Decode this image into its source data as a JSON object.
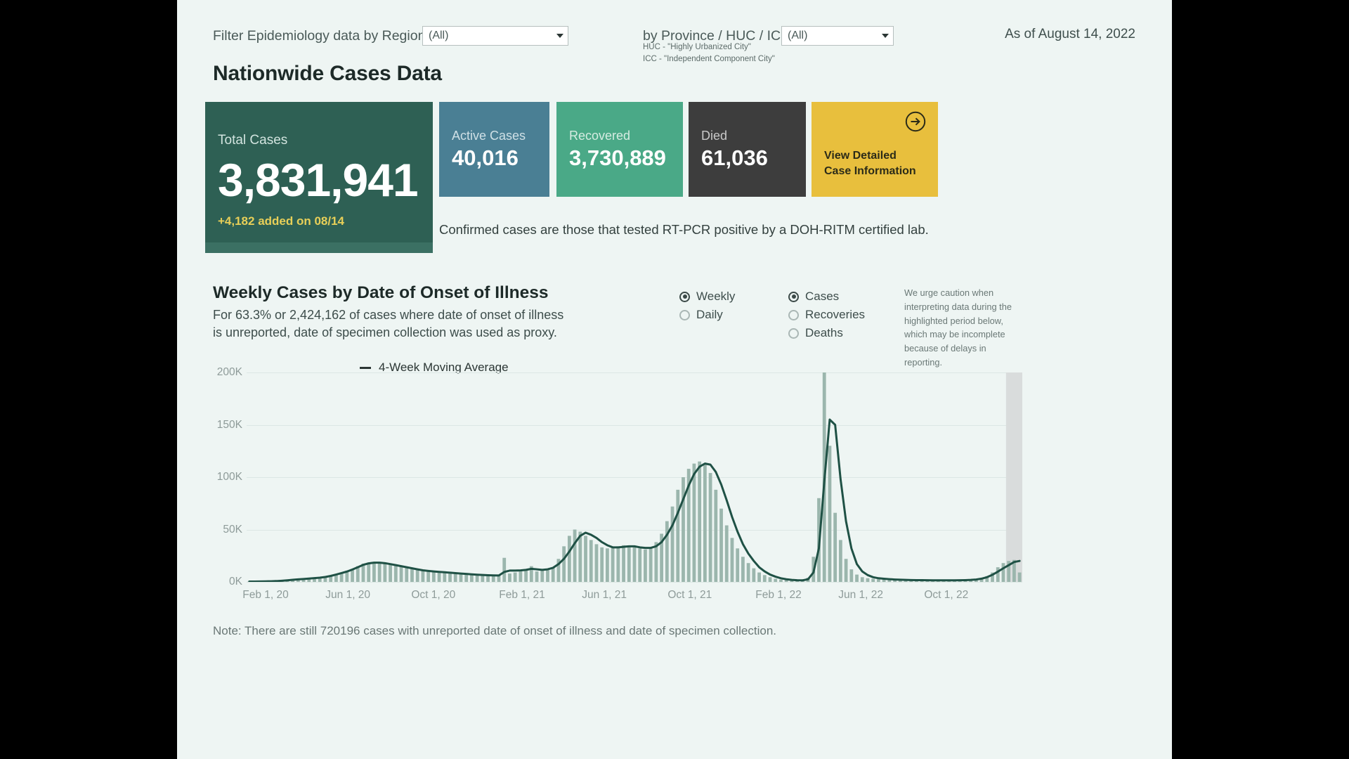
{
  "filters": {
    "region_label": "Filter Epidemiology data by Region:",
    "region_value": "(All)",
    "province_label": "by Province / HUC / ICC:",
    "province_value": "(All)",
    "as_of": "As of August 14, 2022",
    "footnote_huc": "HUC - \"Highly Urbanized City\"",
    "footnote_icc": "ICC - \"Independent Component City\""
  },
  "section": {
    "title": "Nationwide Cases Data",
    "note": "Confirmed cases are those that tested RT-PCR positive by a DOH-RITM certified lab."
  },
  "cards": {
    "total": {
      "label": "Total Cases",
      "value": "3,831,941",
      "delta": "+4,182 added on 08/14",
      "color": "#2e6054"
    },
    "active": {
      "label": "Active Cases",
      "value": "40,016",
      "color": "#4a7f94"
    },
    "recovered": {
      "label": "Recovered",
      "value": "3,730,889",
      "color": "#4aa987"
    },
    "died": {
      "label": "Died",
      "value": "61,036",
      "color": "#3d3d3d"
    },
    "detail": {
      "line1": "View Detailed",
      "line2": "Case Information",
      "color": "#e8bf3d",
      "icon": "arrow-right-circle-icon"
    }
  },
  "chart_section": {
    "title": "Weekly Cases by Date of Onset of Illness",
    "subtitle": "For 63.3% or 2,424,162 of cases where date of onset of illness is unreported, date of specimen collection was used as proxy.",
    "period_options": [
      {
        "label": "Weekly",
        "selected": true
      },
      {
        "label": "Daily",
        "selected": false
      }
    ],
    "metric_options": [
      {
        "label": "Cases",
        "selected": true
      },
      {
        "label": "Recoveries",
        "selected": false
      },
      {
        "label": "Deaths",
        "selected": false
      }
    ],
    "caution": "We urge caution when interpreting data during the highlighted period below, which may be incomplete because of delays in reporting.",
    "legend": "4-Week Moving Average",
    "bottom_note": "Note: There are still 720196 cases with unreported date of onset of illness and date of specimen collection."
  },
  "chart_data": {
    "type": "bar",
    "title": "Weekly Cases by Date of Onset of Illness",
    "xlabel": "",
    "ylabel": "",
    "ylim": [
      0,
      200000
    ],
    "yticks": [
      0,
      50000,
      100000,
      150000,
      200000
    ],
    "ytick_labels": [
      "0K",
      "50K",
      "100K",
      "150K",
      "200K"
    ],
    "grid": true,
    "legend_position": "top-left",
    "xtick_labels": [
      "Feb 1, 20",
      "Jun 1, 20",
      "Oct 1, 20",
      "Feb 1, 21",
      "Jun 1, 21",
      "Oct 1, 21",
      "Feb 1, 22",
      "Jun 1, 22",
      "Oct 1, 22"
    ],
    "xtick_positions": [
      0.0245,
      0.1306,
      0.2408,
      0.3551,
      0.4612,
      0.5714,
      0.6857,
      0.7918,
      0.902
    ],
    "x_start": "Jan 2020",
    "x_end": "Oct 2022",
    "bar_color": "#9bb6ad",
    "line_color": "#1f5145",
    "highlight_color": "#d9dcdc",
    "highlight_note": "incomplete recent reporting period highlighted in grey",
    "series": [
      {
        "name": "Weekly Cases",
        "type": "bar",
        "values": [
          200,
          300,
          400,
          500,
          600,
          800,
          1200,
          1800,
          2200,
          2600,
          3000,
          3400,
          3800,
          4200,
          5000,
          6200,
          7600,
          9000,
          10500,
          12500,
          15000,
          17500,
          18500,
          19000,
          18500,
          17500,
          16500,
          15500,
          14500,
          13500,
          12500,
          11500,
          10500,
          10000,
          9500,
          9000,
          8500,
          8000,
          7500,
          7000,
          6800,
          6500,
          6300,
          6200,
          6000,
          6000,
          6200,
          23000,
          8000,
          9000,
          10000,
          11000,
          15000,
          10000,
          11000,
          12000,
          14000,
          22000,
          34000,
          44000,
          50000,
          48000,
          44000,
          40000,
          36000,
          33000,
          32000,
          33000,
          34000,
          35000,
          34000,
          33000,
          32000,
          31000,
          33000,
          38000,
          46000,
          58000,
          72000,
          88000,
          100000,
          108000,
          113000,
          115000,
          113000,
          104000,
          88000,
          70000,
          54000,
          42000,
          32000,
          24000,
          18000,
          13000,
          9000,
          6500,
          4500,
          3000,
          2200,
          1800,
          1500,
          1300,
          1500,
          4000,
          24000,
          80000,
          210000,
          130000,
          66000,
          40000,
          22000,
          12000,
          7000,
          4500,
          3500,
          3000,
          2600,
          2400,
          2200,
          2000,
          1900,
          1800,
          1700,
          1600,
          1600,
          1500,
          1500,
          1500,
          1500,
          1600,
          1600,
          1700,
          1800,
          2000,
          2500,
          3500,
          5500,
          9000,
          14000,
          18000,
          20000,
          21000,
          9000
        ]
      },
      {
        "name": "4-Week Moving Average",
        "type": "line",
        "values": [
          300,
          350,
          420,
          500,
          620,
          800,
          1100,
          1500,
          2000,
          2400,
          2800,
          3200,
          3600,
          4000,
          4700,
          5700,
          7000,
          8400,
          9900,
          11800,
          14000,
          16300,
          17700,
          18400,
          18400,
          17900,
          17000,
          16000,
          15000,
          14000,
          13000,
          12000,
          11100,
          10500,
          10000,
          9600,
          9200,
          8800,
          8400,
          8000,
          7600,
          7200,
          6900,
          6600,
          6400,
          6200,
          6100,
          9500,
          10800,
          10800,
          11000,
          11500,
          12500,
          12000,
          11500,
          12000,
          13500,
          17000,
          22000,
          29000,
          37000,
          44000,
          47000,
          45000,
          42000,
          38000,
          35000,
          33000,
          33000,
          33500,
          34000,
          34000,
          33000,
          32500,
          32500,
          34000,
          38000,
          45000,
          54000,
          66000,
          79000,
          92000,
          103000,
          110000,
          113000,
          112000,
          105000,
          93000,
          78000,
          62000,
          48000,
          36000,
          27000,
          20000,
          14000,
          10000,
          7000,
          5000,
          3500,
          2500,
          1900,
          1600,
          1500,
          2500,
          9000,
          32000,
          96000,
          155000,
          150000,
          98000,
          58000,
          32000,
          17000,
          10000,
          6500,
          4500,
          3500,
          3000,
          2600,
          2300,
          2100,
          1900,
          1800,
          1700,
          1650,
          1600,
          1550,
          1500,
          1500,
          1500,
          1550,
          1600,
          1700,
          1900,
          2300,
          3100,
          4500,
          6800,
          9800,
          13000,
          16000,
          19000,
          20000
        ]
      }
    ],
    "highlight_region": {
      "start_index": 140,
      "end_index": 142
    }
  }
}
